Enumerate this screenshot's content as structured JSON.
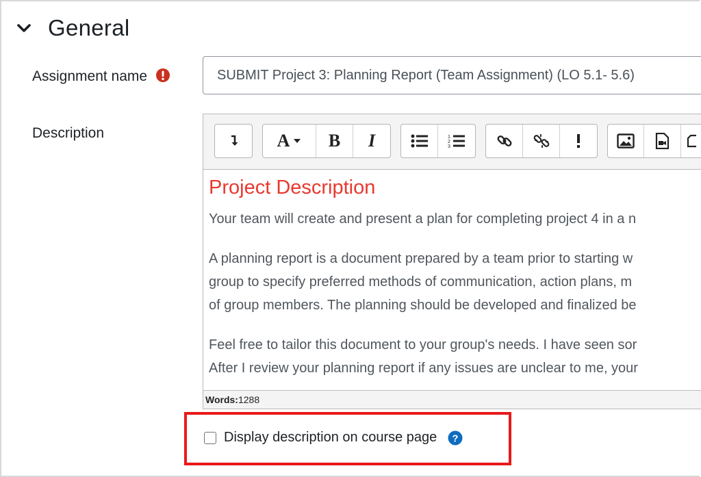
{
  "section": {
    "title": "General",
    "toggle_icon": "chevron-down-icon"
  },
  "assignment_name": {
    "label": "Assignment name",
    "value": "SUBMIT Project 3: Planning Report (Team Assignment) (LO 5.1- 5.6)",
    "required_icon": "exclamation-circle-icon",
    "required_color": "#ca3120"
  },
  "description": {
    "label": "Description",
    "toolbar": [
      "collapse",
      "font-style",
      "bold",
      "italic",
      "unordered-list",
      "ordered-list",
      "link",
      "unlink",
      "equation",
      "image",
      "media",
      "manage-files"
    ],
    "content": {
      "heading": "Project Description",
      "heading_color": "#e8392f",
      "paragraphs": [
        [
          "Your team will create and present a plan for completing project 4 in a n"
        ],
        [
          "A planning report is a document prepared by a team prior to starting w",
          "group to specify preferred methods of communication, action plans, m",
          "of group members.  The planning should be developed and finalized be"
        ],
        [
          "Feel free to tailor this document to your group's needs. I have seen sor",
          "After I review your planning report if any issues are unclear to me, your"
        ]
      ]
    },
    "word_count_label": "Words:",
    "word_count": "1288"
  },
  "display_description": {
    "label": "Display description on course page",
    "checked": false,
    "help_icon": "question-circle-icon",
    "help_color": "#0f6cbf"
  },
  "highlight_color": "#e8191b"
}
